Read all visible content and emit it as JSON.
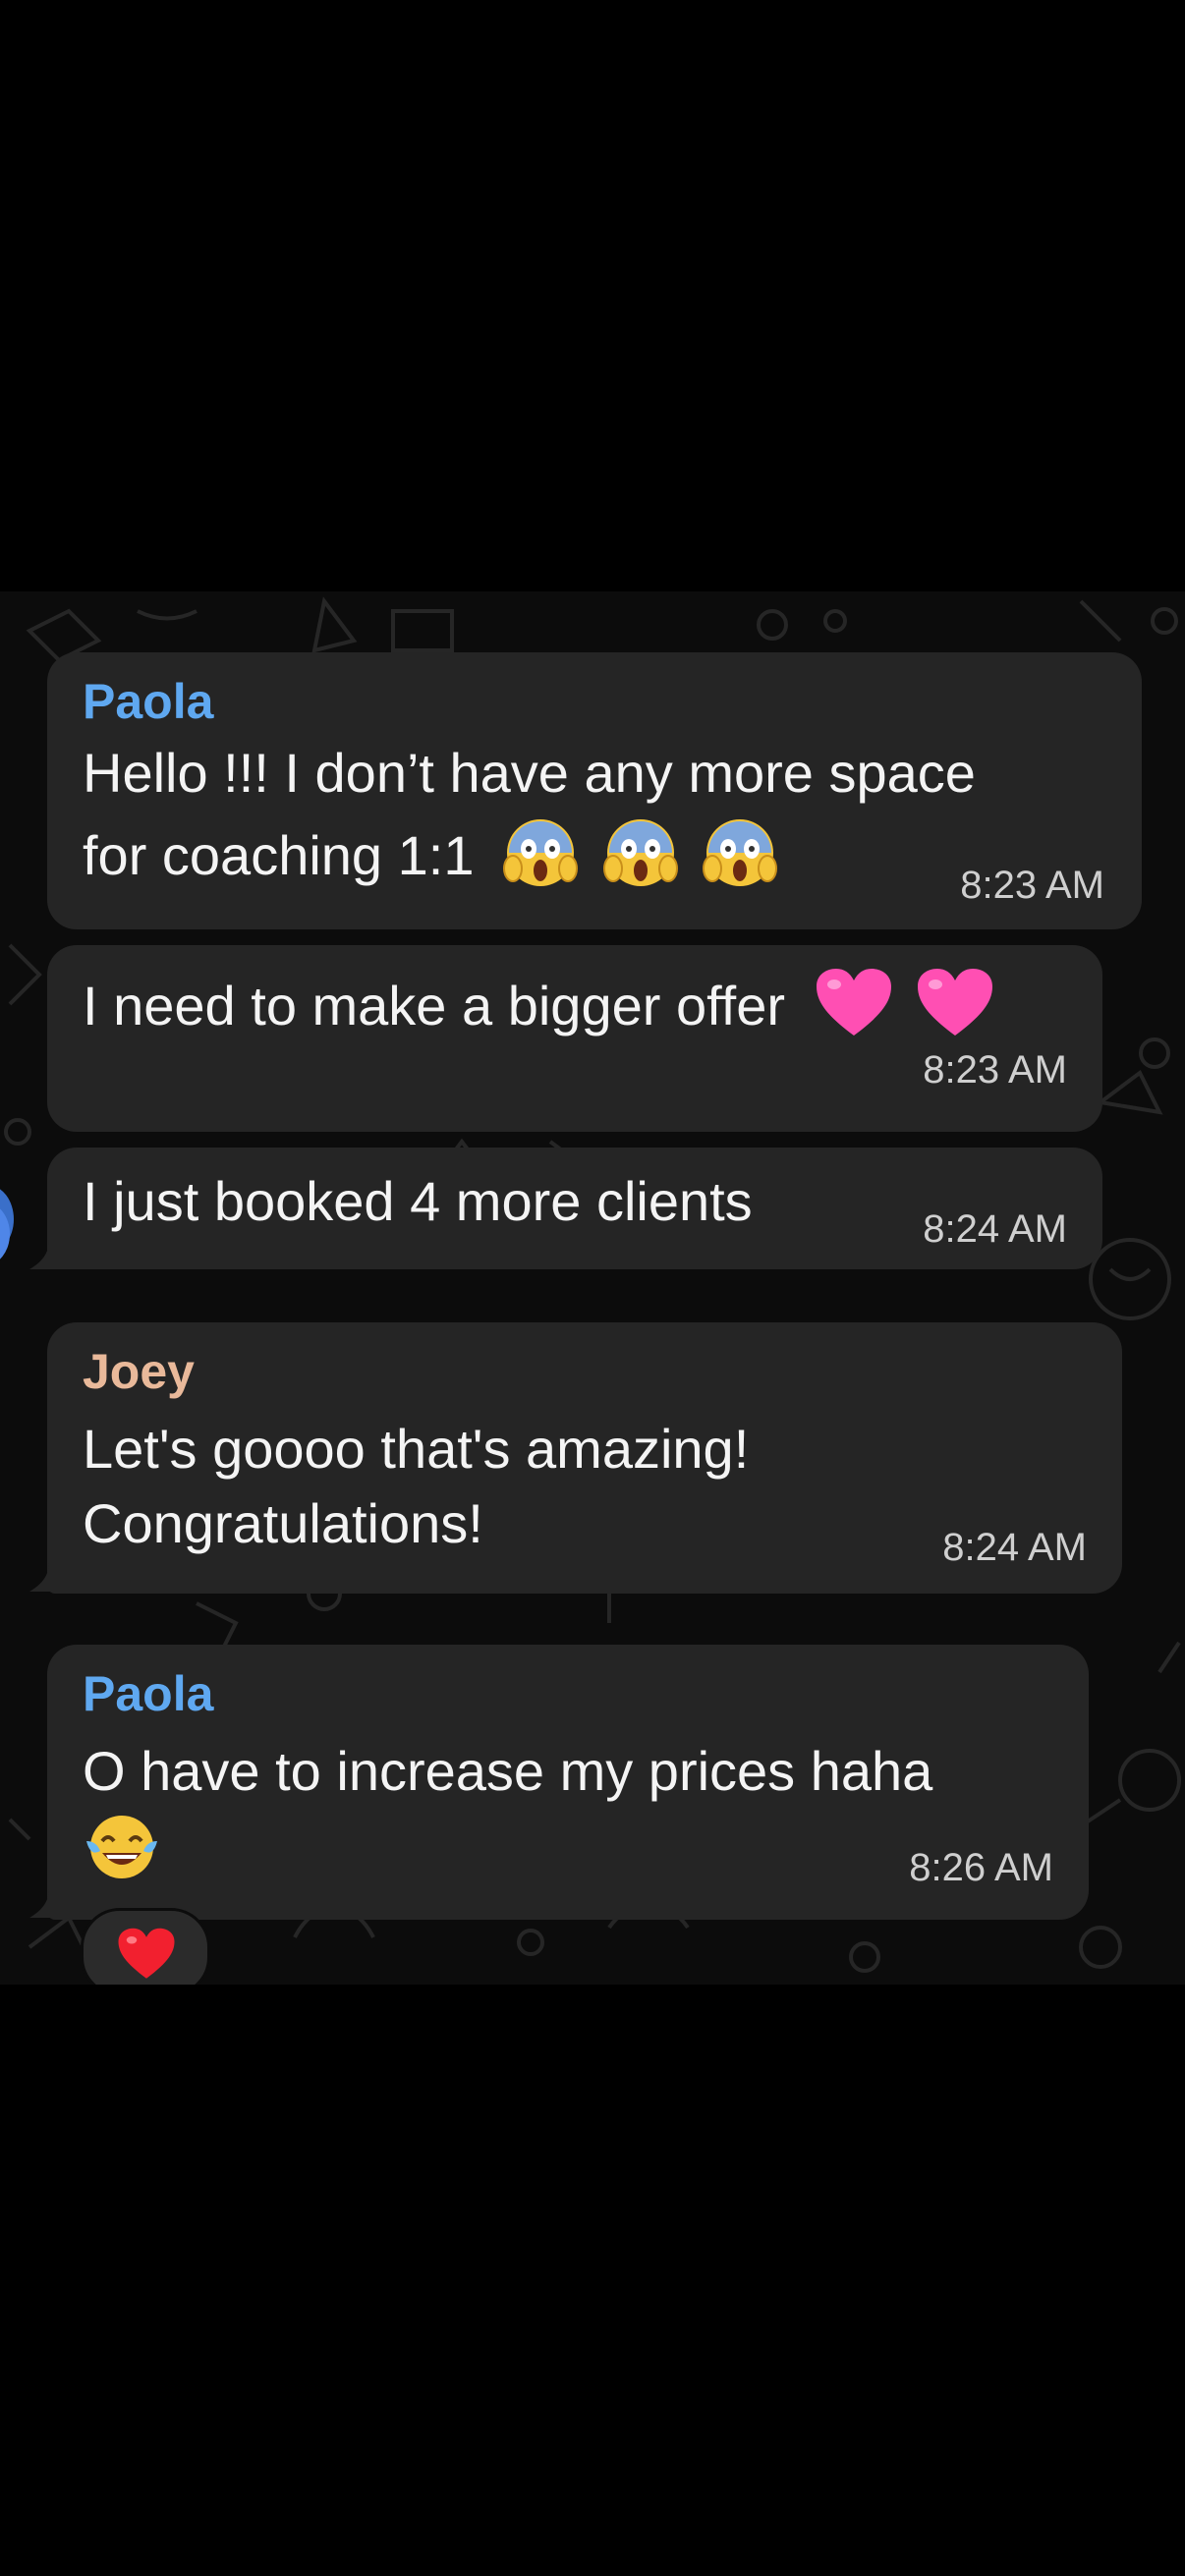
{
  "colors": {
    "background": "#000000",
    "chat_background": "#0c0c0c",
    "bubble": "#252525",
    "paola_name": "#5fa8f0",
    "joey_name": "#e9b99a",
    "message_text": "#f4f4f4",
    "timestamp": "#cfcfcf"
  },
  "messages": [
    {
      "sender": "Paola",
      "lines": [
        "Hello !!! I don’t have any more space",
        "for coaching 1:1"
      ],
      "emoji_names": [
        "face-screaming-in-fear",
        "face-screaming-in-fear",
        "face-screaming-in-fear"
      ],
      "time": "8:23 AM"
    },
    {
      "lines": [
        "I need to make a bigger offer"
      ],
      "emoji_names": [
        "pink-heart",
        "pink-heart"
      ],
      "time": "8:23 AM"
    },
    {
      "lines": [
        "I just booked 4 more clients"
      ],
      "time": "8:24 AM"
    },
    {
      "sender": "Joey",
      "lines": [
        "Let's goooo that's amazing!",
        "Congratulations!"
      ],
      "time": "8:24 AM"
    },
    {
      "sender": "Paola",
      "lines": [
        "O have to increase my prices haha"
      ],
      "emoji_names": [
        "face-with-tears-of-joy"
      ],
      "time": "8:26 AM",
      "reaction": "red-heart"
    }
  ]
}
